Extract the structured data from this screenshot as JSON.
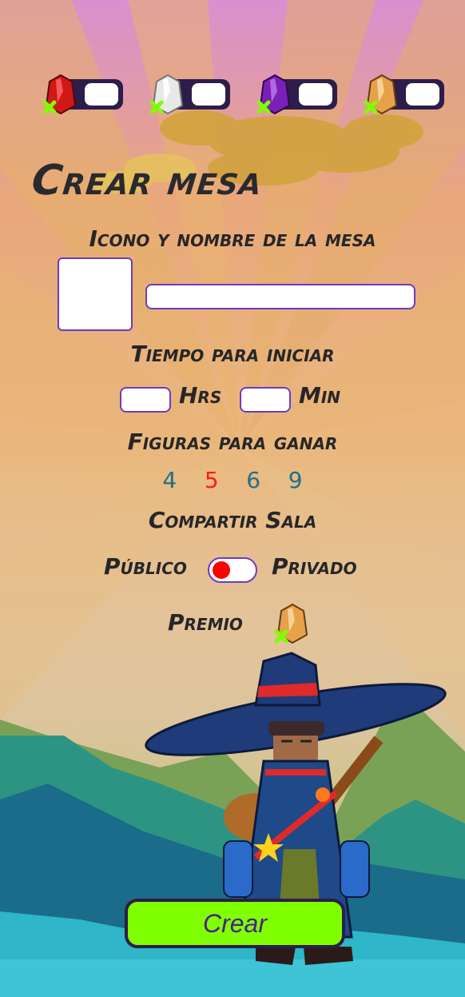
{
  "resources": [
    {
      "icon": "red-gem-icon",
      "color": "#e01818",
      "count": ""
    },
    {
      "icon": "white-gem-icon",
      "color": "#e8e8e8",
      "count": ""
    },
    {
      "icon": "purple-gem-icon",
      "color": "#7a1fb8",
      "count": ""
    },
    {
      "icon": "gold-gem-icon",
      "color": "#e6a24a",
      "count": ""
    }
  ],
  "title": "Crear mesa",
  "icon_name_label": "Icono y nombre de la mesa",
  "table_name": {
    "value": "",
    "placeholder": ""
  },
  "start_time_label": "Tiempo para iniciar",
  "hours": {
    "value": "",
    "unit": "Hrs"
  },
  "minutes": {
    "value": "",
    "unit": "Min"
  },
  "figures_label": "Figuras para ganar",
  "figures": {
    "options": [
      "4",
      "5",
      "6",
      "9"
    ],
    "selected": "5"
  },
  "share_label": "Compartir Sala",
  "share_toggle": {
    "left": "Público",
    "right": "Privado",
    "state": "Público"
  },
  "prize_label": "Premio",
  "prize_icon": "gold-gem-icon",
  "create_button": "Crear",
  "colors": {
    "accent": "#7fff00",
    "border": "#6a3bc4",
    "selected_figure": "#ff1a1a",
    "figure": "#1f6f8b"
  }
}
